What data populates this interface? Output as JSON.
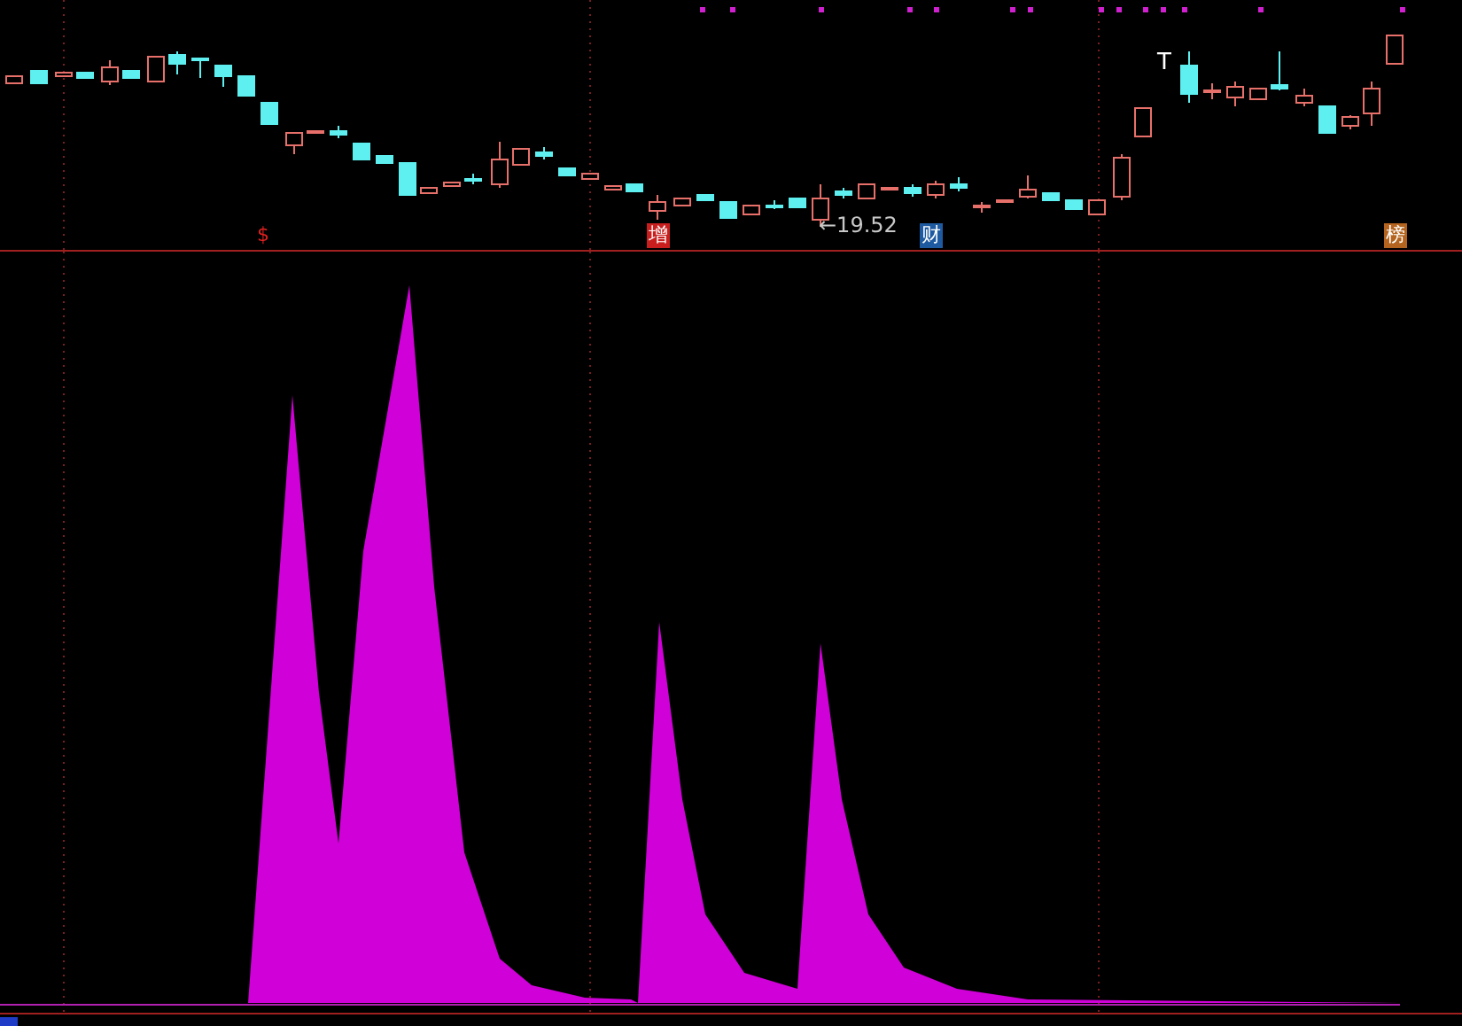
{
  "candle_chart": {
    "signal_marker": "T",
    "low_price_label": "←19.52",
    "event_badges": [
      {
        "text": "$",
        "kind": "plain",
        "color": "#e02020"
      },
      {
        "text": "增",
        "kind": "filled",
        "color": "#c81e1e"
      },
      {
        "text": "财",
        "kind": "filled",
        "color": "#1e5aa0"
      },
      {
        "text": "榜",
        "kind": "filled",
        "color": "#b4641e"
      }
    ]
  }
}
